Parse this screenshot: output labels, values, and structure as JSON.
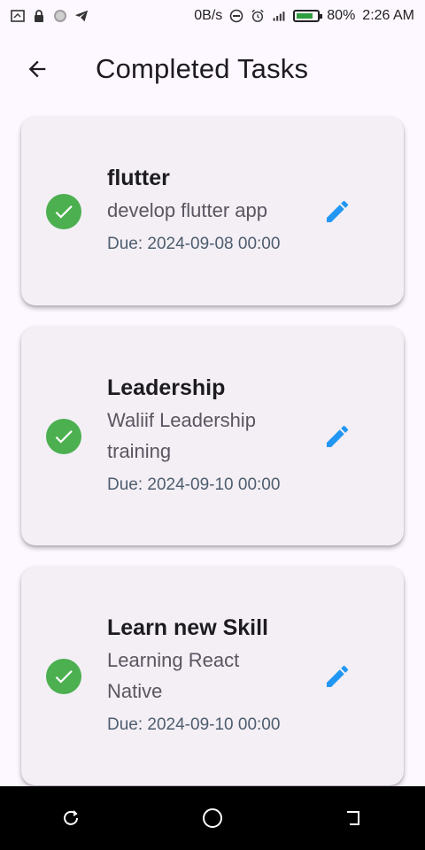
{
  "status_bar": {
    "network_speed": "0B/s",
    "battery_percent": "80%",
    "battery_level": 0.8,
    "time": "2:26 AM",
    "icons": [
      "screenshot-icon",
      "lock-icon",
      "circle-icon",
      "telegram-icon",
      "dnd-icon",
      "alarm-icon",
      "signal-icon",
      "battery-icon"
    ]
  },
  "app_bar": {
    "title": "Completed Tasks",
    "back_icon": "arrow-back-icon"
  },
  "tasks": [
    {
      "title": "flutter",
      "description": "develop flutter app",
      "due": "Due: 2024-09-08 00:00"
    },
    {
      "title": "Leadership",
      "description": "Waliif Leadership training",
      "due": "Due: 2024-09-10 00:00"
    },
    {
      "title": "Learn new Skill",
      "description": "Learning React Native",
      "due": "Due: 2024-09-10 00:00"
    }
  ],
  "colors": {
    "background": "#fdf7ff",
    "card": "#f3eff5",
    "check_green": "#4caf50",
    "edit_blue": "#2196f3",
    "nav_bar": "#000000"
  },
  "nav_bar": {
    "buttons": [
      "recents-button",
      "home-button",
      "back-nav-button"
    ]
  }
}
